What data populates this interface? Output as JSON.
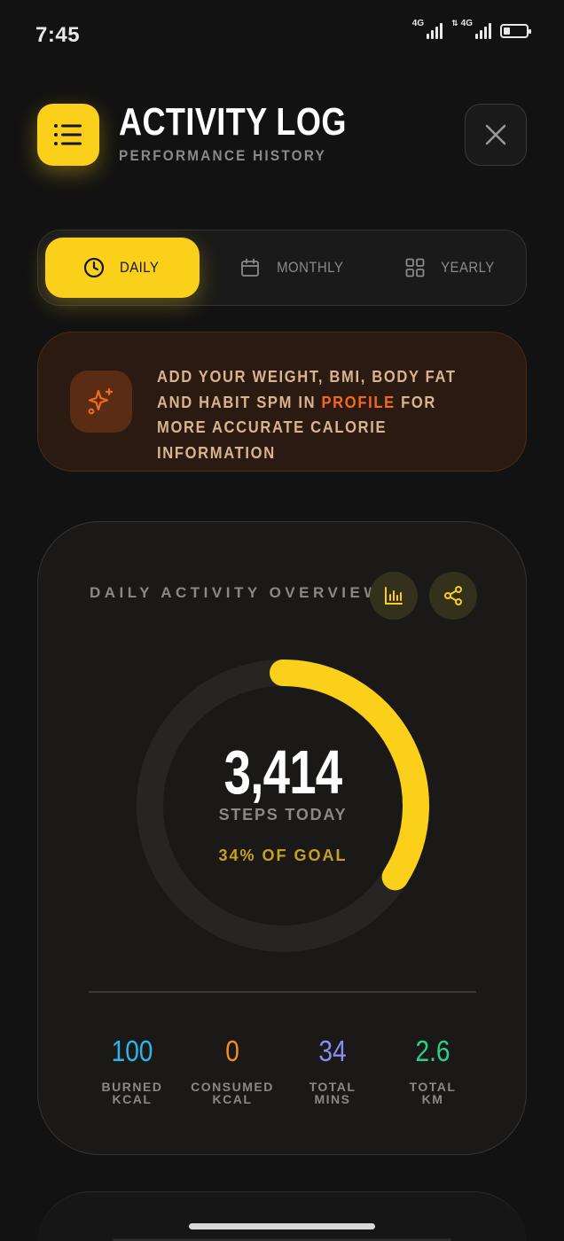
{
  "status_bar": {
    "time": "7:45",
    "network_1": "4G",
    "network_2": "4G",
    "battery_level": 0.3
  },
  "header": {
    "title": "ACTIVITY LOG",
    "subtitle": "PERFORMANCE HISTORY",
    "menu_icon": "list-icon",
    "close_icon": "close-icon"
  },
  "tabs": [
    {
      "label": "DAILY",
      "icon": "clock-icon",
      "active": true
    },
    {
      "label": "MONTHLY",
      "icon": "calendar-icon",
      "active": false
    },
    {
      "label": "YEARLY",
      "icon": "grid-icon",
      "active": false
    }
  ],
  "banner": {
    "icon": "sparkles-icon",
    "text_before": "ADD YOUR WEIGHT, BMI, BODY FAT AND HABIT SPM IN ",
    "highlight": "PROFILE",
    "text_after": " FOR MORE ACCURATE CALORIE INFORMATION"
  },
  "overview": {
    "title": "DAILY ACTIVITY OVERVIEW",
    "chart_icon": "bar-chart-icon",
    "share_icon": "share-icon",
    "steps_value": "3,414",
    "steps_label": "STEPS TODAY",
    "goal_label": "34% OF GOAL",
    "goal_fraction": 0.34,
    "stats": [
      {
        "value": "100",
        "label": "BURNED\nKCAL",
        "color": "#29b6e8"
      },
      {
        "value": "0",
        "label": "CONSUMED\nKCAL",
        "color": "#f28c28"
      },
      {
        "value": "34",
        "label": "TOTAL\nMINS",
        "color": "#8c8cf0"
      },
      {
        "value": "2.6",
        "label": "TOTAL\nKM",
        "color": "#2ecf8a"
      }
    ]
  },
  "colors": {
    "accent": "#fbd01b",
    "highlight": "#f26b1d",
    "ring_track": "#262522"
  }
}
